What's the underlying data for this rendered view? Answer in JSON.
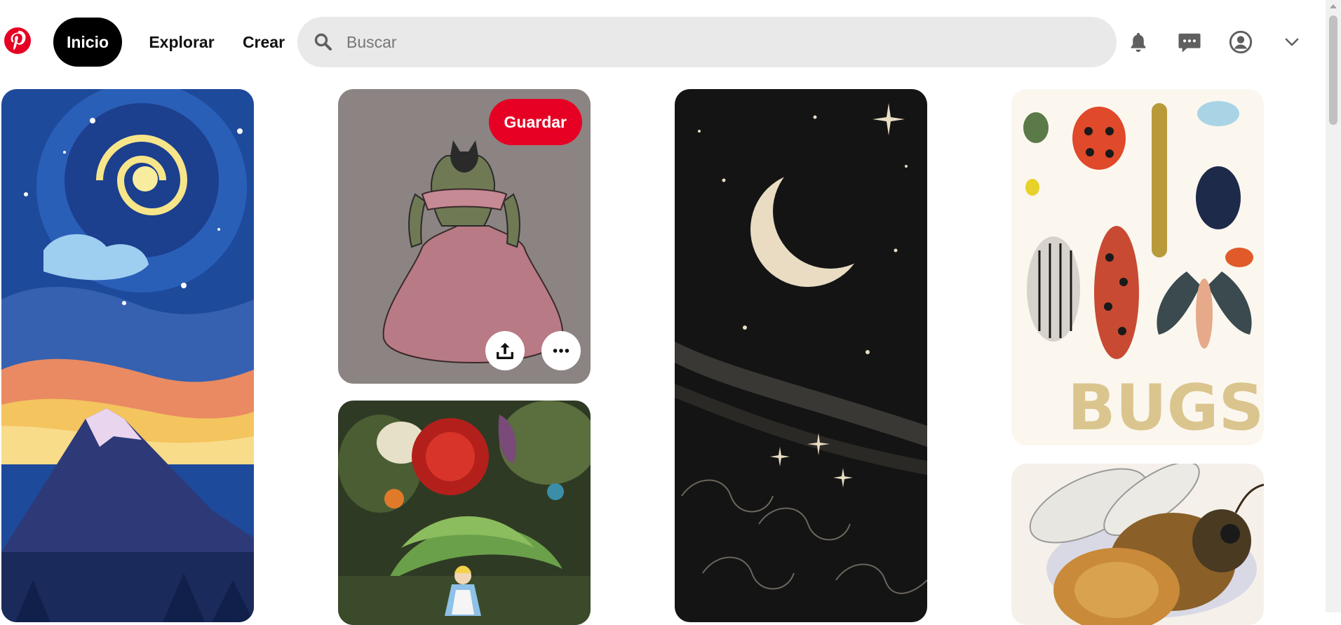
{
  "header": {
    "logo_icon": "pinterest-logo",
    "nav": {
      "home": "Inicio",
      "explore": "Explorar",
      "create": "Crear"
    },
    "search": {
      "placeholder": "Buscar",
      "value": ""
    },
    "icons": [
      "bell-icon",
      "messages-icon",
      "profile-icon",
      "chevron-down-icon"
    ]
  },
  "pins": [
    {
      "subject": "starry-night-mountain"
    },
    {
      "subject": "batman-in-pink-gown",
      "save_label": "Guardar",
      "actions": [
        "share-icon",
        "more-icon"
      ]
    },
    {
      "subject": "alice-in-flower-garden"
    },
    {
      "subject": "crescent-moon-night-sky"
    },
    {
      "subject": "bugs-poster",
      "poster_text": "BUGS"
    },
    {
      "subject": "bee-closeup"
    }
  ],
  "colors": {
    "brand": "#e60023",
    "search_bg": "#e9e9e9",
    "active_nav_bg": "#000000"
  }
}
